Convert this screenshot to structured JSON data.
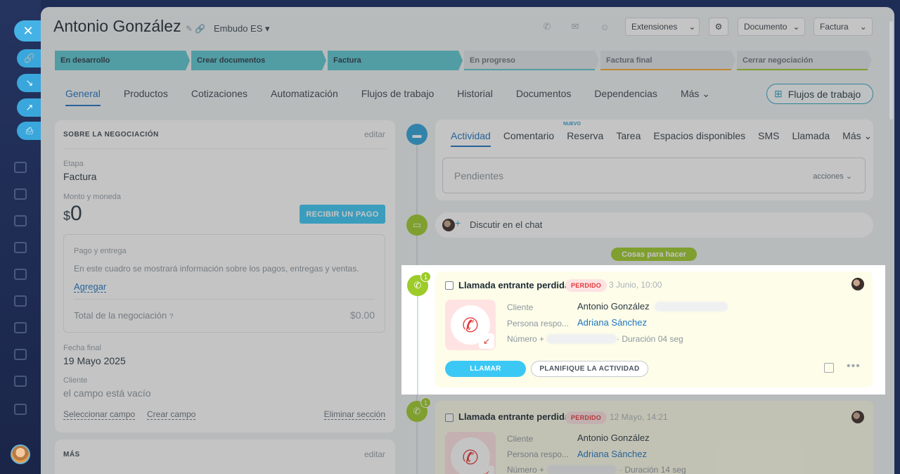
{
  "header": {
    "title": "Antonio González",
    "funnel": "Embudo ES",
    "extensions": "Extensiones",
    "document": "Documento",
    "invoice": "Factura"
  },
  "stages": [
    {
      "label": "En desarrollo",
      "state": "done",
      "color": "#5cc6d2"
    },
    {
      "label": "Crear documentos",
      "state": "done",
      "color": "#5cc6d2"
    },
    {
      "label": "Factura",
      "state": "done",
      "color": "#5cc6d2"
    },
    {
      "label": "En progreso",
      "state": "todo",
      "color": "#5cc6d2"
    },
    {
      "label": "Factura final",
      "state": "todo",
      "color": "#f2a733"
    },
    {
      "label": "Cerrar negociación",
      "state": "todo",
      "color": "#9ccb2a"
    }
  ],
  "tabs": [
    "General",
    "Productos",
    "Cotizaciones",
    "Automatización",
    "Flujos de trabajo",
    "Historial",
    "Documentos",
    "Dependencias",
    "Más"
  ],
  "workflows_button": "Flujos de trabajo",
  "deal": {
    "section_title": "SOBRE LA NEGOCIACIÓN",
    "edit": "editar",
    "stage_label": "Etapa",
    "stage_value": "Factura",
    "amount_label": "Monto y moneda",
    "currency": "$",
    "amount": "0",
    "receive_payment": "RECIBIR UN PAGO",
    "payment_title": "Pago y entrega",
    "payment_desc": "En este cuadro se mostrará información sobre los pagos, entregas y ventas.",
    "add": "Agregar",
    "total_label": "Total de la negociación",
    "total_value": "$0.00",
    "close_date_label": "Fecha final",
    "close_date_value": "19 Mayo 2025",
    "client_label": "Cliente",
    "client_value": "el campo está vacío",
    "select_field": "Seleccionar campo",
    "create_field": "Crear campo",
    "delete_section": "Eliminar sección",
    "more_title": "MÁS",
    "more_edit": "editar"
  },
  "activity": {
    "tabs": [
      "Actividad",
      "Comentario",
      "Reserva",
      "Tarea",
      "Espacios disponibles",
      "SMS",
      "Llamada",
      "Más"
    ],
    "new_badge": "NUEVO",
    "pending": "Pendientes",
    "actions": "acciones",
    "chat": "Discutir en el chat",
    "todo_pill": "Cosas para hacer"
  },
  "calls": [
    {
      "title": "Llamada entrante perdida",
      "status": "PERDIDO",
      "date": "3 Junio, 10:00",
      "client_label": "Cliente",
      "client": "Antonio González",
      "responsible_label": "Persona respo...",
      "responsible": "Adriana Sánchez",
      "number_label": "Número +",
      "duration": "· Duración 04 seg",
      "call_btn": "LLAMAR",
      "plan_btn": "PLANIFIQUE LA ACTIVIDAD",
      "count": "1"
    },
    {
      "title": "Llamada entrante perdida",
      "status": "PERDIDO",
      "date": "12 Mayo, 14:21",
      "client_label": "Cliente",
      "client": "Antonio González",
      "responsible_label": "Persona respo...",
      "responsible": "Adriana Sánchez",
      "number_label": "Número +",
      "duration": "· Duración 14 seg",
      "count": "1"
    }
  ]
}
